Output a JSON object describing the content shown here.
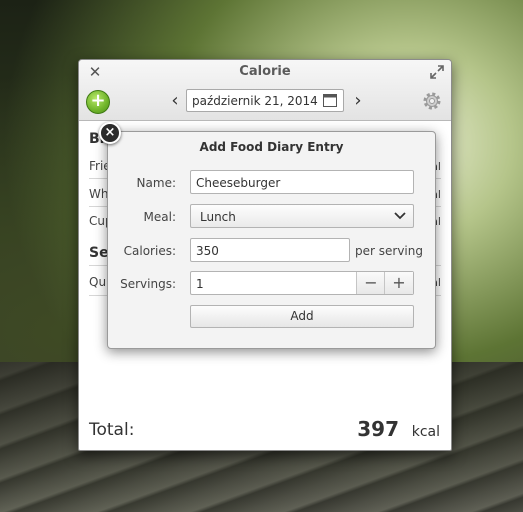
{
  "window": {
    "title": "Calorie",
    "date": "październik 21, 2014",
    "add_icon": "+"
  },
  "diary": {
    "sections": [
      {
        "title": "Bre",
        "items": [
          "Frie",
          "Whe",
          "Cup"
        ]
      },
      {
        "title": "Sec",
        "items": [
          "Qui"
        ]
      }
    ],
    "kcal_fragment": "cal",
    "total_label": "Total:",
    "total_value": "397",
    "total_unit": "kcal"
  },
  "dialog": {
    "title": "Add Food Diary Entry",
    "close_glyph": "×",
    "name_label": "Name:",
    "name_value": "Cheeseburger",
    "meal_label": "Meal:",
    "meal_value": "Lunch",
    "calories_label": "Calories:",
    "calories_value": "350",
    "calories_unit": "per serving",
    "servings_label": "Servings:",
    "servings_value": "1",
    "minus": "−",
    "plus": "+",
    "add_label": "Add"
  },
  "icons": {
    "close": "close-icon",
    "maximize": "maximize-icon",
    "add": "add-circle-icon",
    "prev": "chevron-left-icon",
    "next": "chevron-right-icon",
    "calendar": "calendar-icon",
    "settings": "gear-icon",
    "dropdown": "chevron-down-icon"
  },
  "colors": {
    "accent_green": "#6fb42a",
    "window_bg": "#ffffff",
    "dialog_bg": "#f3f3f3"
  }
}
